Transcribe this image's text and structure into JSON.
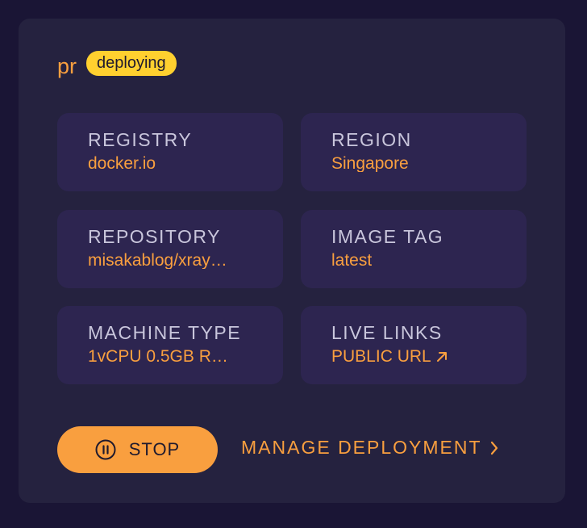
{
  "deployment": {
    "name": "pr",
    "status": "deploying"
  },
  "details": [
    {
      "label": "REGISTRY",
      "value": "docker.io"
    },
    {
      "label": "REGION",
      "value": "Singapore"
    },
    {
      "label": "REPOSITORY",
      "value": "misakablog/xray…"
    },
    {
      "label": "IMAGE TAG",
      "value": "latest"
    },
    {
      "label": "MACHINE TYPE",
      "value": "1vCPU 0.5GB R…"
    },
    {
      "label": "LIVE LINKS",
      "value": "PUBLIC URL"
    }
  ],
  "actions": {
    "stop_label": "STOP",
    "manage_label": "MANAGE DEPLOYMENT"
  },
  "icons": {
    "stop": "pause-circle-icon",
    "external": "arrow-up-right-icon",
    "chevron": "chevron-right-icon"
  },
  "colors": {
    "background": "#1a1535",
    "card": "#25223f",
    "tile": "#2d2550",
    "accent": "#f99f3f",
    "badge": "#ffd02f",
    "label": "#c9c6dc"
  }
}
